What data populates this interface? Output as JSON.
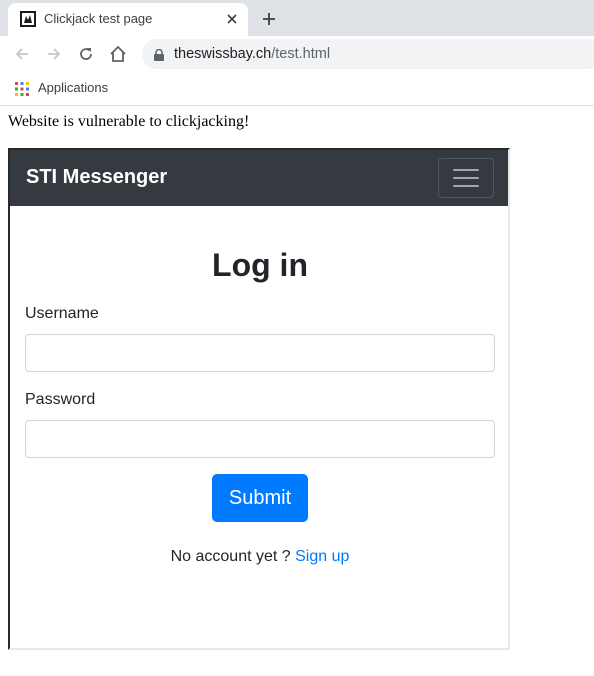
{
  "browser": {
    "tab_title": "Clickjack test page",
    "url_host": "theswissbay.ch",
    "url_path": "/test.html",
    "bookmark_apps": "Applications"
  },
  "page": {
    "vulnerable_text": "Website is vulnerable to clickjacking!"
  },
  "frame": {
    "brand": "STI Messenger",
    "heading": "Log in",
    "username_label": "Username",
    "username_value": "",
    "password_label": "Password",
    "password_value": "",
    "submit_label": "Submit",
    "no_account_text": "No account yet ?",
    "signup_link": "Sign up"
  },
  "colors": {
    "navbar": "#343a40",
    "primary": "#007bff",
    "tabbar": "#dee1e6"
  },
  "icons": [
    "favicon-icon",
    "close-icon",
    "plus-icon",
    "back-arrow-icon",
    "forward-arrow-icon",
    "reload-icon",
    "home-icon",
    "lock-icon",
    "apps-grid-icon",
    "hamburger-icon"
  ]
}
